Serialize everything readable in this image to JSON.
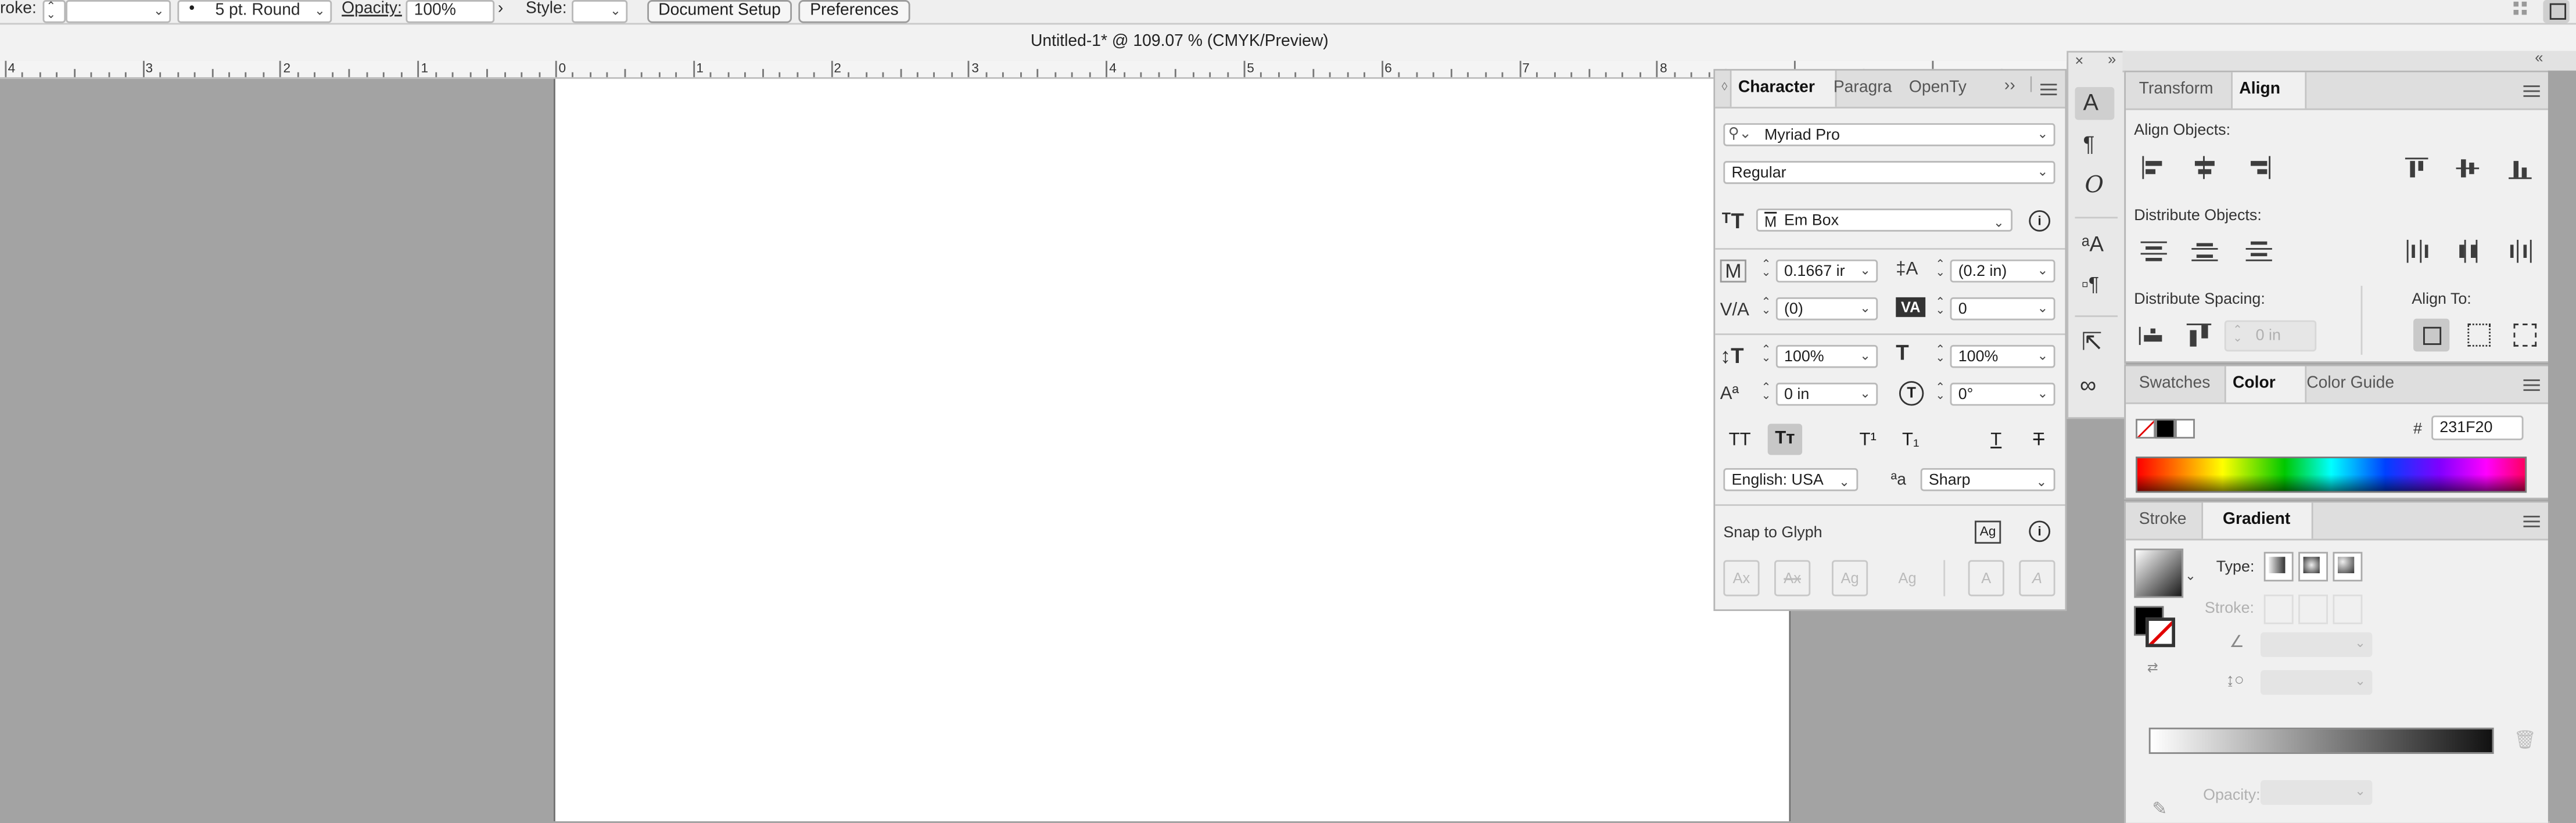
{
  "control_bar": {
    "stroke_label": "roke:",
    "brush_label": "5 pt. Round",
    "opacity_label": "Opacity:",
    "opacity_value": "100%",
    "style_label": "Style:",
    "document_setup_button": "Document Setup",
    "preferences_button": "Preferences"
  },
  "document": {
    "title": "Untitled-1* @ 109.07 % (CMYK/Preview)"
  },
  "ruler": {
    "labels": [
      "4",
      "3",
      "2",
      "1",
      "0",
      "1",
      "2",
      "3",
      "4",
      "5",
      "6",
      "7",
      "8"
    ]
  },
  "character_panel": {
    "tabs": [
      "Character",
      "Paragra",
      "OpenTy"
    ],
    "font_family": "Myriad Pro",
    "font_style": "Regular",
    "em_box": "Em Box",
    "font_size": "0.1667 ir",
    "leading": "(0.2 in)",
    "kerning": "(0)",
    "tracking": "0",
    "vertical_scale": "100%",
    "horizontal_scale": "100%",
    "baseline_shift": "0 in",
    "rotation": "0°",
    "style_buttons": [
      "TT",
      "Tт",
      "T¹",
      "T₁",
      "T",
      "T"
    ],
    "language": "English: USA",
    "aa_label": "ªa",
    "antialiasing": "Sharp",
    "snap_to_glyph_label": "Snap to Glyph",
    "snap_buttons": [
      "Ax",
      "Ax",
      "Ag",
      "Ag",
      "A",
      "A"
    ]
  },
  "tool_strip": {
    "icons": [
      "character-icon",
      "paragraph-icon",
      "opentype-icon",
      "glyphs-icon",
      "paragraph-styles-icon",
      "export-icon",
      "links-icon"
    ]
  },
  "align_panel": {
    "tabs": [
      "Transform",
      "Align"
    ],
    "align_objects_label": "Align Objects:",
    "distribute_objects_label": "Distribute Objects:",
    "distribute_spacing_label": "Distribute Spacing:",
    "align_to_label": "Align To:",
    "spacing_value": "0 in"
  },
  "color_panel": {
    "tabs": [
      "Swatches",
      "Color",
      "Color Guide"
    ],
    "hash_label": "#",
    "hex_value": "231F20"
  },
  "gradient_panel": {
    "tabs": [
      "Stroke",
      "Gradient"
    ],
    "type_label": "Type:",
    "stroke_label": "Stroke:",
    "opacity_label": "Opacity:"
  }
}
